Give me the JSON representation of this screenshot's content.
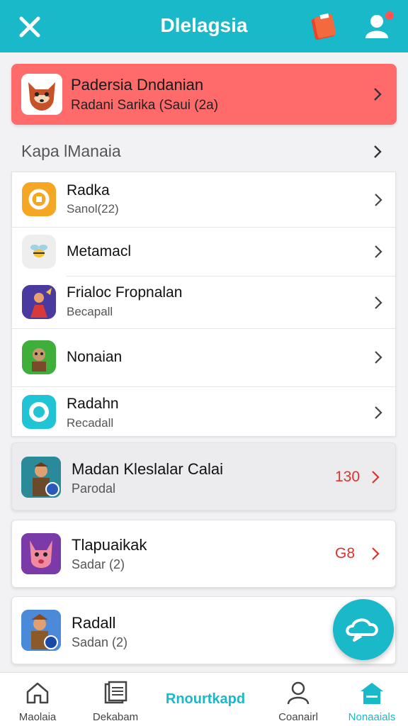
{
  "header": {
    "title": "Dlelagsia",
    "close_icon": "close-icon",
    "book_icon": "book-icon",
    "user_icon": "user-icon"
  },
  "hero": {
    "title": "Padersia Dndanian",
    "subtitle": "Radani Sarika (Saui (2a)",
    "color": "#ff6a6a"
  },
  "section": {
    "title": "Kapa lManaia"
  },
  "list": [
    {
      "name": "Radka",
      "sub": "Sanol(22)",
      "icon": "coin-icon",
      "icon_color": "#f5a623"
    },
    {
      "name": "Metamacl",
      "sub": "",
      "icon": "bee-icon",
      "icon_color": "#eeeeee"
    },
    {
      "name": "Frialoc Fropnalan",
      "sub": "Becapall",
      "icon": "hero-icon",
      "icon_color": "#5a3ea8"
    },
    {
      "name": "Nonaian",
      "sub": "",
      "icon": "goblin-icon",
      "icon_color": "#3fae3a"
    },
    {
      "name": "Radahn",
      "sub": "Recadall",
      "icon": "ring-icon",
      "icon_color": "#21c4d4"
    }
  ],
  "games": [
    {
      "name": "Madan Kleslalar Calai",
      "sub": "Parodal",
      "count": "130",
      "icon": "warrior-icon",
      "bg": "#ececee"
    },
    {
      "name": "Tlapuaikak",
      "sub": "Sadar (2)",
      "count": "G8",
      "icon": "dog-icon",
      "bg": "#ffffff"
    },
    {
      "name": "Radall",
      "sub": "Sadan (2)",
      "count": "",
      "icon": "soldier-icon",
      "bg": "#ffffff"
    }
  ],
  "fab": {
    "icon": "chat-cloud-icon"
  },
  "accent_color": "#19b9c9",
  "count_color": "#e0322d",
  "bottom_nav": [
    {
      "label": "Maolaia",
      "icon": "home-icon",
      "active": false
    },
    {
      "label": "Dekabam",
      "icon": "document-icon",
      "active": false
    },
    {
      "label": "Rnourtkapd",
      "icon": "",
      "active": true
    },
    {
      "label": "Coanairl",
      "icon": "person-icon",
      "active": false
    },
    {
      "label": "Nonaaials",
      "icon": "store-icon",
      "active": true
    }
  ]
}
